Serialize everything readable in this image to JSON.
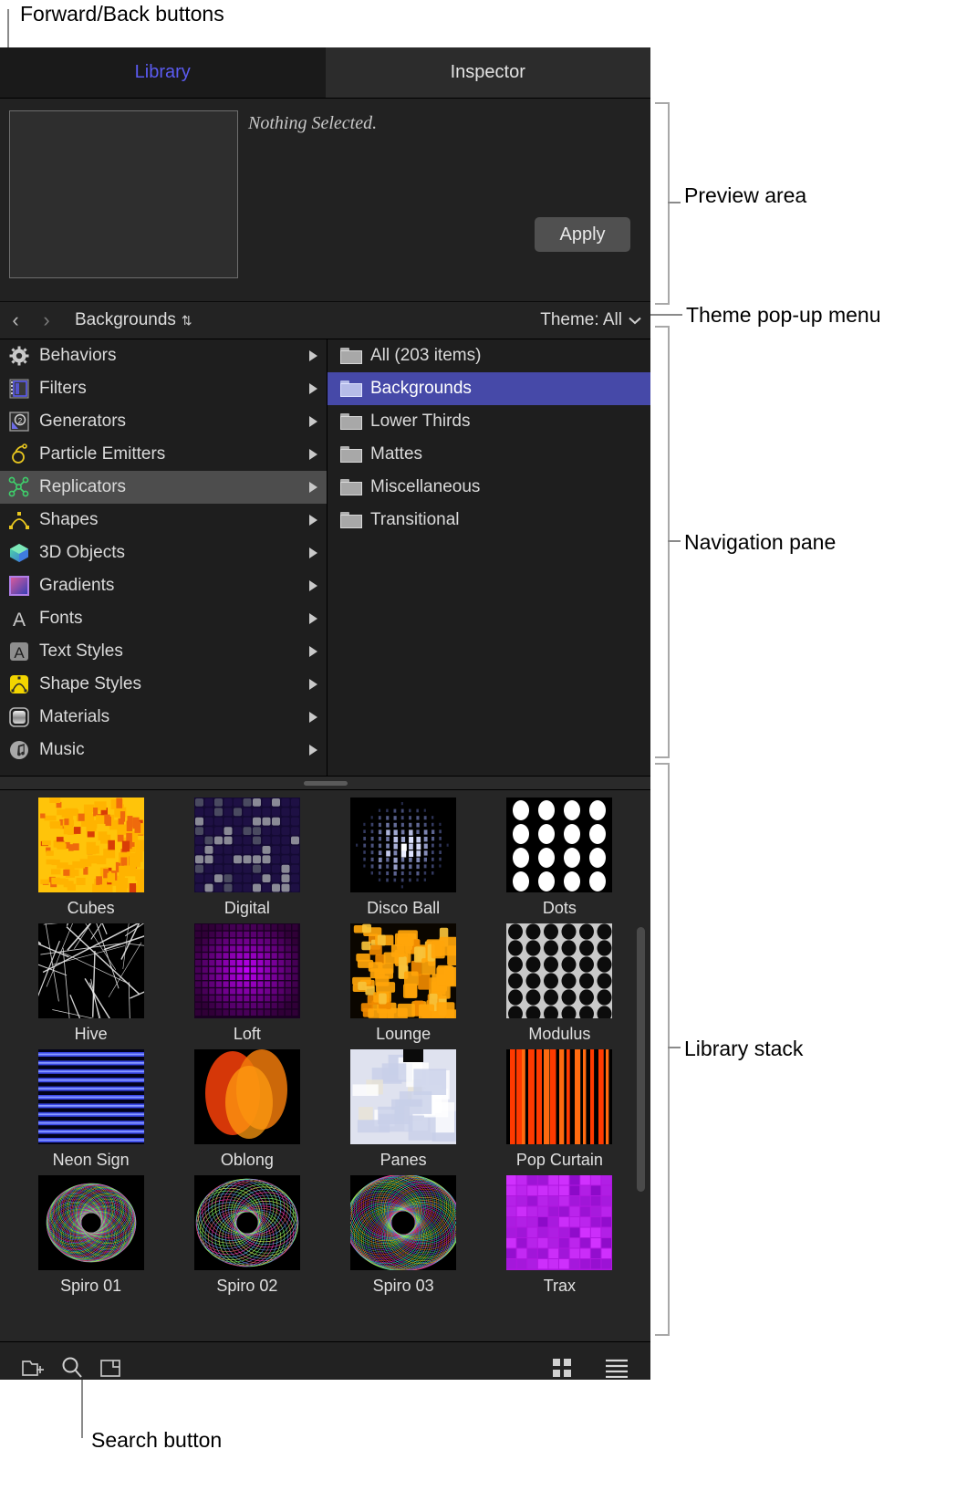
{
  "annotations": {
    "forward_back": "Forward/Back buttons",
    "preview_area": "Preview area",
    "theme_popup": "Theme pop-up menu",
    "navigation_pane": "Navigation pane",
    "library_stack": "Library stack",
    "search_button": "Search button"
  },
  "tabs": [
    {
      "label": "Library",
      "active": true
    },
    {
      "label": "Inspector",
      "active": false
    }
  ],
  "preview": {
    "message": "Nothing Selected.",
    "apply_label": "Apply"
  },
  "pathbar": {
    "back_glyph": "‹",
    "forward_glyph": "›",
    "path_label": "Backgrounds",
    "sort_glyph": "⇅",
    "theme_label": "Theme: All",
    "theme_chevron": "⌄"
  },
  "sidebar": {
    "items": [
      {
        "label": "Behaviors",
        "icon": "gear-icon",
        "selected": false
      },
      {
        "label": "Filters",
        "icon": "film-strip-icon",
        "selected": false
      },
      {
        "label": "Generators",
        "icon": "generator-icon",
        "selected": false
      },
      {
        "label": "Particle Emitters",
        "icon": "particle-emitter-icon",
        "selected": false
      },
      {
        "label": "Replicators",
        "icon": "replicator-icon",
        "selected": true
      },
      {
        "label": "Shapes",
        "icon": "shapes-icon",
        "selected": false
      },
      {
        "label": "3D Objects",
        "icon": "cube-icon",
        "selected": false
      },
      {
        "label": "Gradients",
        "icon": "gradient-icon",
        "selected": false
      },
      {
        "label": "Fonts",
        "icon": "font-a-icon",
        "selected": false
      },
      {
        "label": "Text Styles",
        "icon": "text-style-icon",
        "selected": false
      },
      {
        "label": "Shape Styles",
        "icon": "shape-style-icon",
        "selected": false
      },
      {
        "label": "Materials",
        "icon": "material-icon",
        "selected": false
      },
      {
        "label": "Music",
        "icon": "music-note-icon",
        "selected": false
      }
    ]
  },
  "categories": {
    "items": [
      {
        "label": "All (203 items)",
        "selected": false
      },
      {
        "label": "Backgrounds",
        "selected": true
      },
      {
        "label": "Lower Thirds",
        "selected": false
      },
      {
        "label": "Mattes",
        "selected": false
      },
      {
        "label": "Miscellaneous",
        "selected": false
      },
      {
        "label": "Transitional",
        "selected": false
      }
    ]
  },
  "stack": {
    "items": [
      {
        "name": "Cubes",
        "thumb": "cubes"
      },
      {
        "name": "Digital",
        "thumb": "digital"
      },
      {
        "name": "Disco Ball",
        "thumb": "discoball"
      },
      {
        "name": "Dots",
        "thumb": "dots"
      },
      {
        "name": "Hive",
        "thumb": "hive"
      },
      {
        "name": "Loft",
        "thumb": "loft"
      },
      {
        "name": "Lounge",
        "thumb": "lounge"
      },
      {
        "name": "Modulus",
        "thumb": "modulus"
      },
      {
        "name": "Neon Sign",
        "thumb": "neonsign"
      },
      {
        "name": "Oblong",
        "thumb": "oblong"
      },
      {
        "name": "Panes",
        "thumb": "panes"
      },
      {
        "name": "Pop Curtain",
        "thumb": "popcurtain"
      },
      {
        "name": "Spiro 01",
        "thumb": "spiro1"
      },
      {
        "name": "Spiro 02",
        "thumb": "spiro2"
      },
      {
        "name": "Spiro 03",
        "thumb": "spiro3"
      },
      {
        "name": "Trax",
        "thumb": "trax"
      }
    ]
  },
  "toolbar": {
    "new_folder": "new-folder-icon",
    "search": "search-icon",
    "new_panel": "new-panel-icon",
    "grid_view": "grid-view-icon",
    "list_view": "list-view-icon"
  },
  "colors": {
    "accent_tab": "#5b5bf0",
    "selection_blue": "#4649a8",
    "selection_grey": "#4d4d4d",
    "window_bg": "#1e1e1e"
  }
}
